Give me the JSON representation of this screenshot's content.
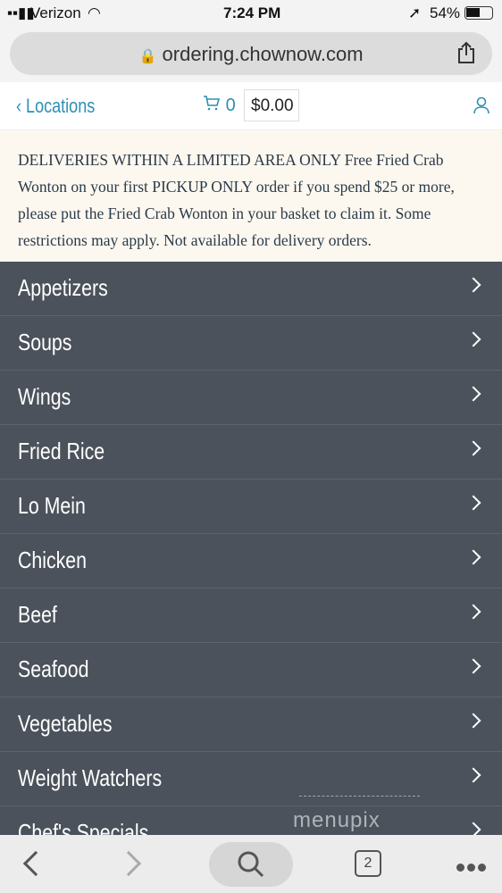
{
  "status": {
    "carrier": "Verizon",
    "time": "7:24 PM",
    "battery": "54%"
  },
  "browser": {
    "url": "ordering.chownow.com",
    "tab_count": "2"
  },
  "nav": {
    "back_label": "Locations",
    "cart_count": "0",
    "cart_total": "$0.00"
  },
  "banner": {
    "text": "DELIVERIES WITHIN A LIMITED AREA ONLY Free Fried Crab Wonton on your first PICKUP ONLY order if you spend $25 or more, please put the Fried Crab Wonton in your basket to claim it. Some restrictions may apply.  Not available for delivery orders."
  },
  "menu": {
    "items": [
      "Appetizers",
      "Soups",
      "Wings",
      "Fried Rice",
      "Lo Mein",
      "Chicken",
      "Beef",
      "Seafood",
      "Vegetables",
      "Weight Watchers",
      "Chef's Specials"
    ]
  },
  "watermark": "menupix",
  "colors": {
    "accent": "#2d8fb5",
    "menu_bg": "#4b525b",
    "banner_bg": "#fdf8ef"
  }
}
